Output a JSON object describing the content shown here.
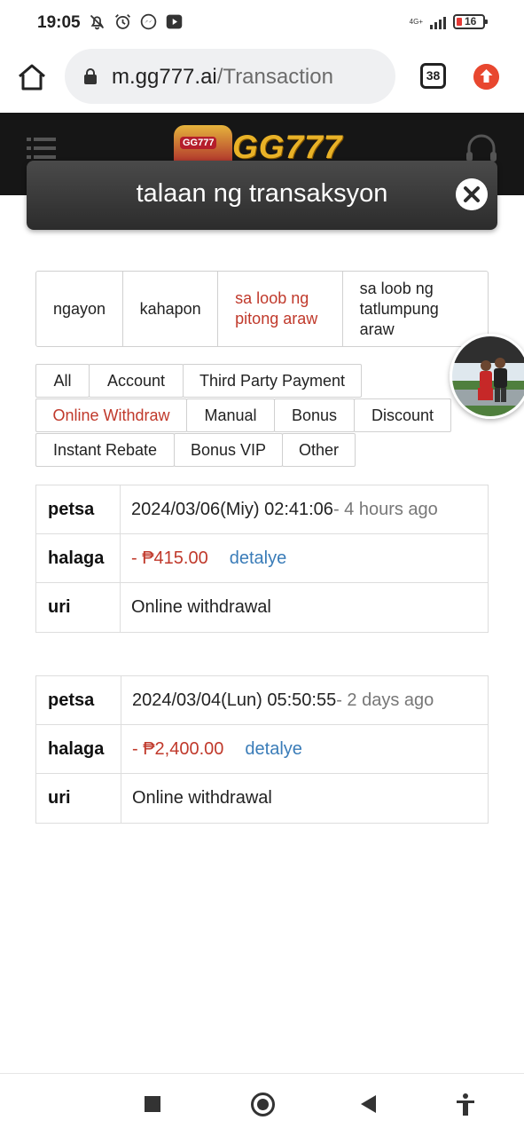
{
  "status_bar": {
    "time": "19:05",
    "icons": [
      "notifications-off-icon",
      "alarm-icon",
      "messenger-icon",
      "youtube-icon"
    ],
    "network": "4G+",
    "battery": "16"
  },
  "browser": {
    "url_host": "m.gg777.ai",
    "url_path": "/Transaction",
    "tab_count": "38"
  },
  "site": {
    "logo_text": "GG777",
    "logo_badge": "GG777"
  },
  "modal": {
    "title": "talaan ng transaksyon"
  },
  "date_filter": [
    {
      "label": "ngayon",
      "active": false
    },
    {
      "label": "kahapon",
      "active": false
    },
    {
      "label": "sa loob ng pitong araw",
      "active": true
    },
    {
      "label": "sa loob ng tatlumpung araw",
      "active": false
    }
  ],
  "type_filter": [
    {
      "label": "All",
      "active": false
    },
    {
      "label": "Account",
      "active": false
    },
    {
      "label": "Third Party Payment",
      "active": false
    },
    {
      "label": "Online Withdraw",
      "active": true
    },
    {
      "label": "Manual",
      "active": false
    },
    {
      "label": "Bonus",
      "active": false
    },
    {
      "label": "Discount",
      "active": false
    },
    {
      "label": "Instant Rebate",
      "active": false
    },
    {
      "label": "Bonus VIP",
      "active": false
    },
    {
      "label": "Other",
      "active": false
    }
  ],
  "labels": {
    "date": "petsa",
    "amount": "halaga",
    "type": "uri",
    "detail": "detalye"
  },
  "transactions": [
    {
      "date": "2024/03/06(Miy) 02:41:06",
      "ago": "- 4 hours ago",
      "amount": "- ₱415.00",
      "type": "Online withdrawal"
    },
    {
      "date": "2024/03/04(Lun) 05:50:55",
      "ago": "- 2 days ago",
      "amount": "- ₱2,400.00",
      "type": "Online withdrawal"
    }
  ]
}
